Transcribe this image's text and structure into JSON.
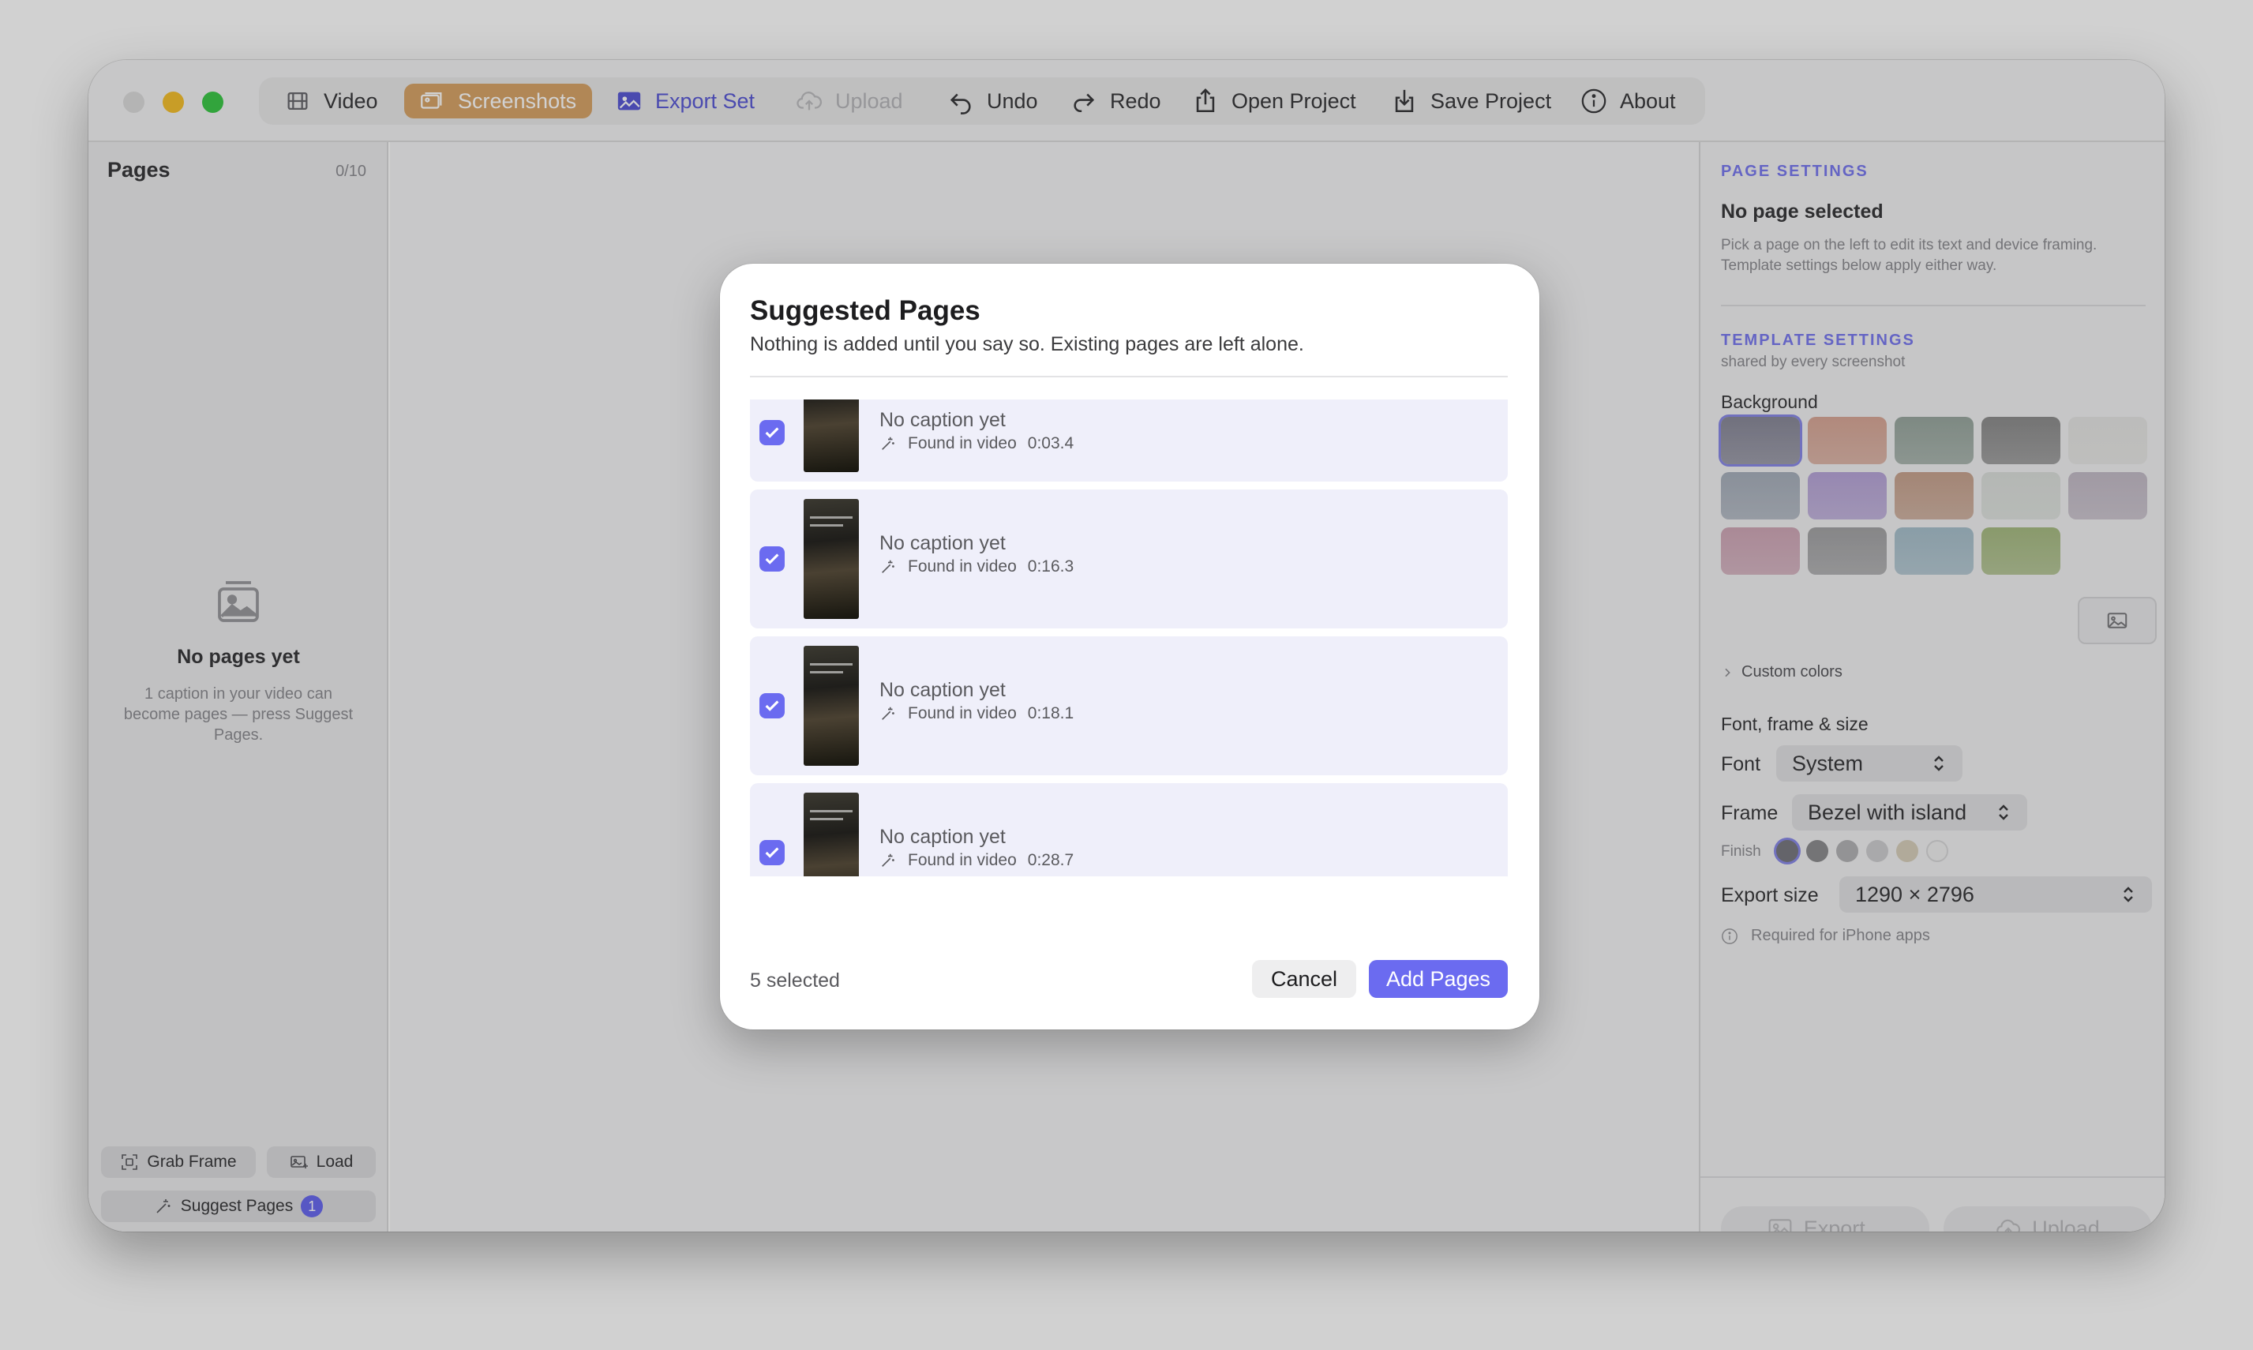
{
  "toolbar": {
    "video": "Video",
    "screenshots": "Screenshots",
    "export_set": "Export Set",
    "upload": "Upload",
    "undo": "Undo",
    "redo": "Redo",
    "open_project": "Open Project",
    "save_project": "Save Project",
    "about": "About"
  },
  "sidebar": {
    "title": "Pages",
    "count": "0/10",
    "empty_title": "No pages yet",
    "empty_sub": "1 caption in your video can become pages — press Suggest Pages.",
    "grab_frame": "Grab Frame",
    "load": "Load",
    "suggest_pages": "Suggest Pages",
    "suggest_badge": "1"
  },
  "right_panel": {
    "page_settings_title": "PAGE SETTINGS",
    "no_page_selected": "No page selected",
    "no_page_hint": "Pick a page on the left to edit its text and device framing. Template settings below apply either way.",
    "template_settings_title": "TEMPLATE SETTINGS",
    "template_settings_sub": "shared by every screenshot",
    "background_label": "Background",
    "backgrounds": [
      "#8a8a9a",
      "#d8a898",
      "#9aa8a0",
      "#8e8e8e",
      "#e6e6e4",
      "#a8b0bc",
      "#b8a6d8",
      "#c8a490",
      "#dce0dc",
      "#c4bcc8",
      "#d0a8b8",
      "#a4a4a6",
      "#a8c0cc",
      "#a8bc84"
    ],
    "custom_colors": "Custom colors",
    "font_frame_size": "Font, frame & size",
    "font_label": "Font",
    "font_value": "System",
    "frame_label": "Frame",
    "frame_value": "Bezel with island",
    "finish_label": "Finish",
    "export_size_label": "Export size",
    "export_size_value": "1290 × 2796",
    "required_note": "Required for iPhone apps",
    "export_button": "Export...",
    "upload_button": "Upload"
  },
  "dialog": {
    "title": "Suggested Pages",
    "subtitle": "Nothing is added until you say so. Existing pages are left alone.",
    "items": [
      {
        "caption": "No caption yet",
        "found_label": "Found in video",
        "time": "0:03.4",
        "checked": true
      },
      {
        "caption": "No caption yet",
        "found_label": "Found in video",
        "time": "0:16.3",
        "checked": true
      },
      {
        "caption": "No caption yet",
        "found_label": "Found in video",
        "time": "0:18.1",
        "checked": true
      },
      {
        "caption": "No caption yet",
        "found_label": "Found in video",
        "time": "0:28.7",
        "checked": true
      }
    ],
    "selected_count": "5 selected",
    "cancel": "Cancel",
    "add_pages": "Add Pages"
  },
  "colors": {
    "accent": "#6b6bf0",
    "screenshots_tab": "#d8a56a"
  }
}
